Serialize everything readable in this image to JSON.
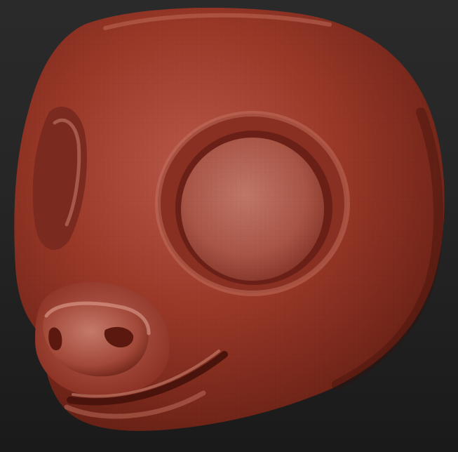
{
  "viewport": {
    "background_top": "#2a2a2a",
    "background_bottom": "#1a1a1a"
  },
  "model": {
    "material_color": "#9a3828",
    "highlight_color": "#d98a76",
    "shadow_color": "#4a140c",
    "icon": "sculpted-creature-head"
  }
}
